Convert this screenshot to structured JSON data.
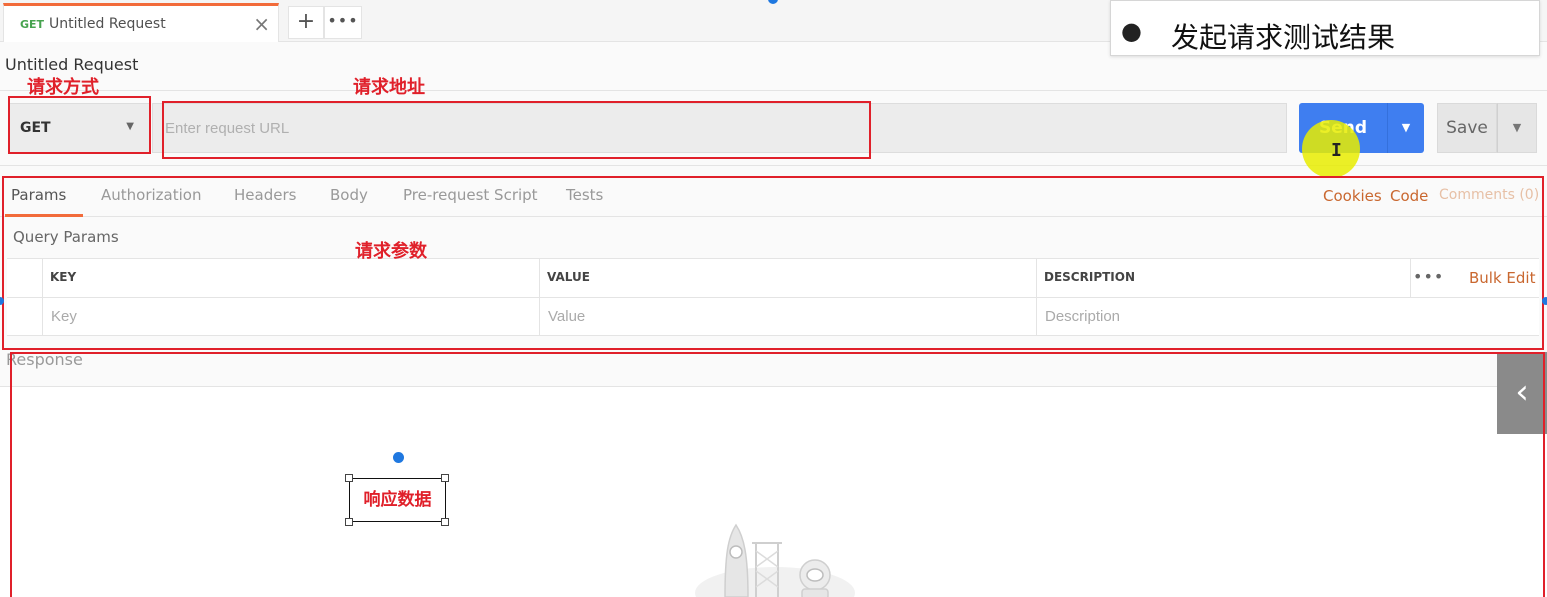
{
  "tab": {
    "method": "GET",
    "name": "Untitled Request",
    "close": "×",
    "add": "+",
    "more": "•••"
  },
  "slide_note": {
    "bullet": "●",
    "text": "发起请求测试结果"
  },
  "request": {
    "title": "Untitled Request",
    "method": "GET",
    "url_placeholder": "Enter request URL",
    "url_value": "",
    "send_label": "Send",
    "save_label": "Save"
  },
  "tabs": [
    {
      "label": "Params",
      "active": true
    },
    {
      "label": "Authorization",
      "active": false
    },
    {
      "label": "Headers",
      "active": false
    },
    {
      "label": "Body",
      "active": false
    },
    {
      "label": "Pre-request Script",
      "active": false
    },
    {
      "label": "Tests",
      "active": false
    }
  ],
  "right_links": {
    "cookies": "Cookies",
    "code": "Code",
    "comments": "Comments (0)"
  },
  "params": {
    "section_title": "Query Params",
    "columns": [
      "KEY",
      "VALUE",
      "DESCRIPTION"
    ],
    "placeholders": {
      "key": "Key",
      "value": "Value",
      "description": "Description"
    },
    "more": "•••",
    "bulk_edit": "Bulk Edit"
  },
  "response": {
    "label": "Response"
  },
  "annotations": {
    "method": "请求方式",
    "url": "请求地址",
    "params": "请求参数",
    "response": "响应数据"
  },
  "colors": {
    "accent": "#f26b3a",
    "send": "#3f7ef0",
    "annotation": "#e0202a",
    "link": "#c9672f"
  },
  "icons": {
    "caret": "▼",
    "chevron_left": "‹",
    "cursor": "I"
  }
}
